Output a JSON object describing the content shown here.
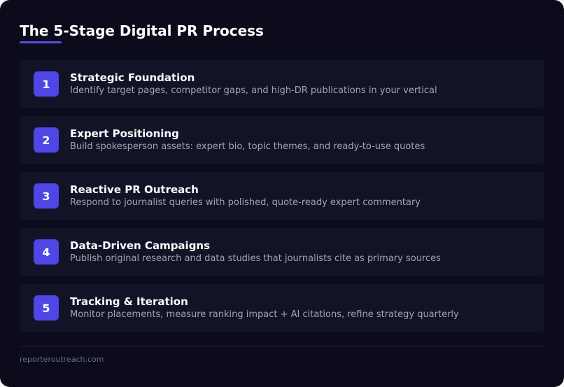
{
  "title": "The 5-Stage Digital PR Process",
  "colors": {
    "background": "#0b0b1c",
    "card": "#131328",
    "accent": "#4f46e5",
    "title_text": "#ffffff",
    "description_text": "#a4a4b8"
  },
  "steps": [
    {
      "number": "1",
      "title": "Strategic Foundation",
      "description": "Identify target pages, competitor gaps, and high-DR publications in your vertical"
    },
    {
      "number": "2",
      "title": "Expert Positioning",
      "description": "Build spokesperson assets: expert bio, topic themes, and ready-to-use quotes"
    },
    {
      "number": "3",
      "title": "Reactive PR Outreach",
      "description": "Respond to journalist queries with polished, quote-ready expert commentary"
    },
    {
      "number": "4",
      "title": "Data-Driven Campaigns",
      "description": "Publish original research and data studies that journalists cite as primary sources"
    },
    {
      "number": "5",
      "title": "Tracking & Iteration",
      "description": "Monitor placements, measure ranking impact + AI citations, refine strategy quarterly"
    }
  ],
  "footer": {
    "source": "reporteroutreach.com"
  }
}
